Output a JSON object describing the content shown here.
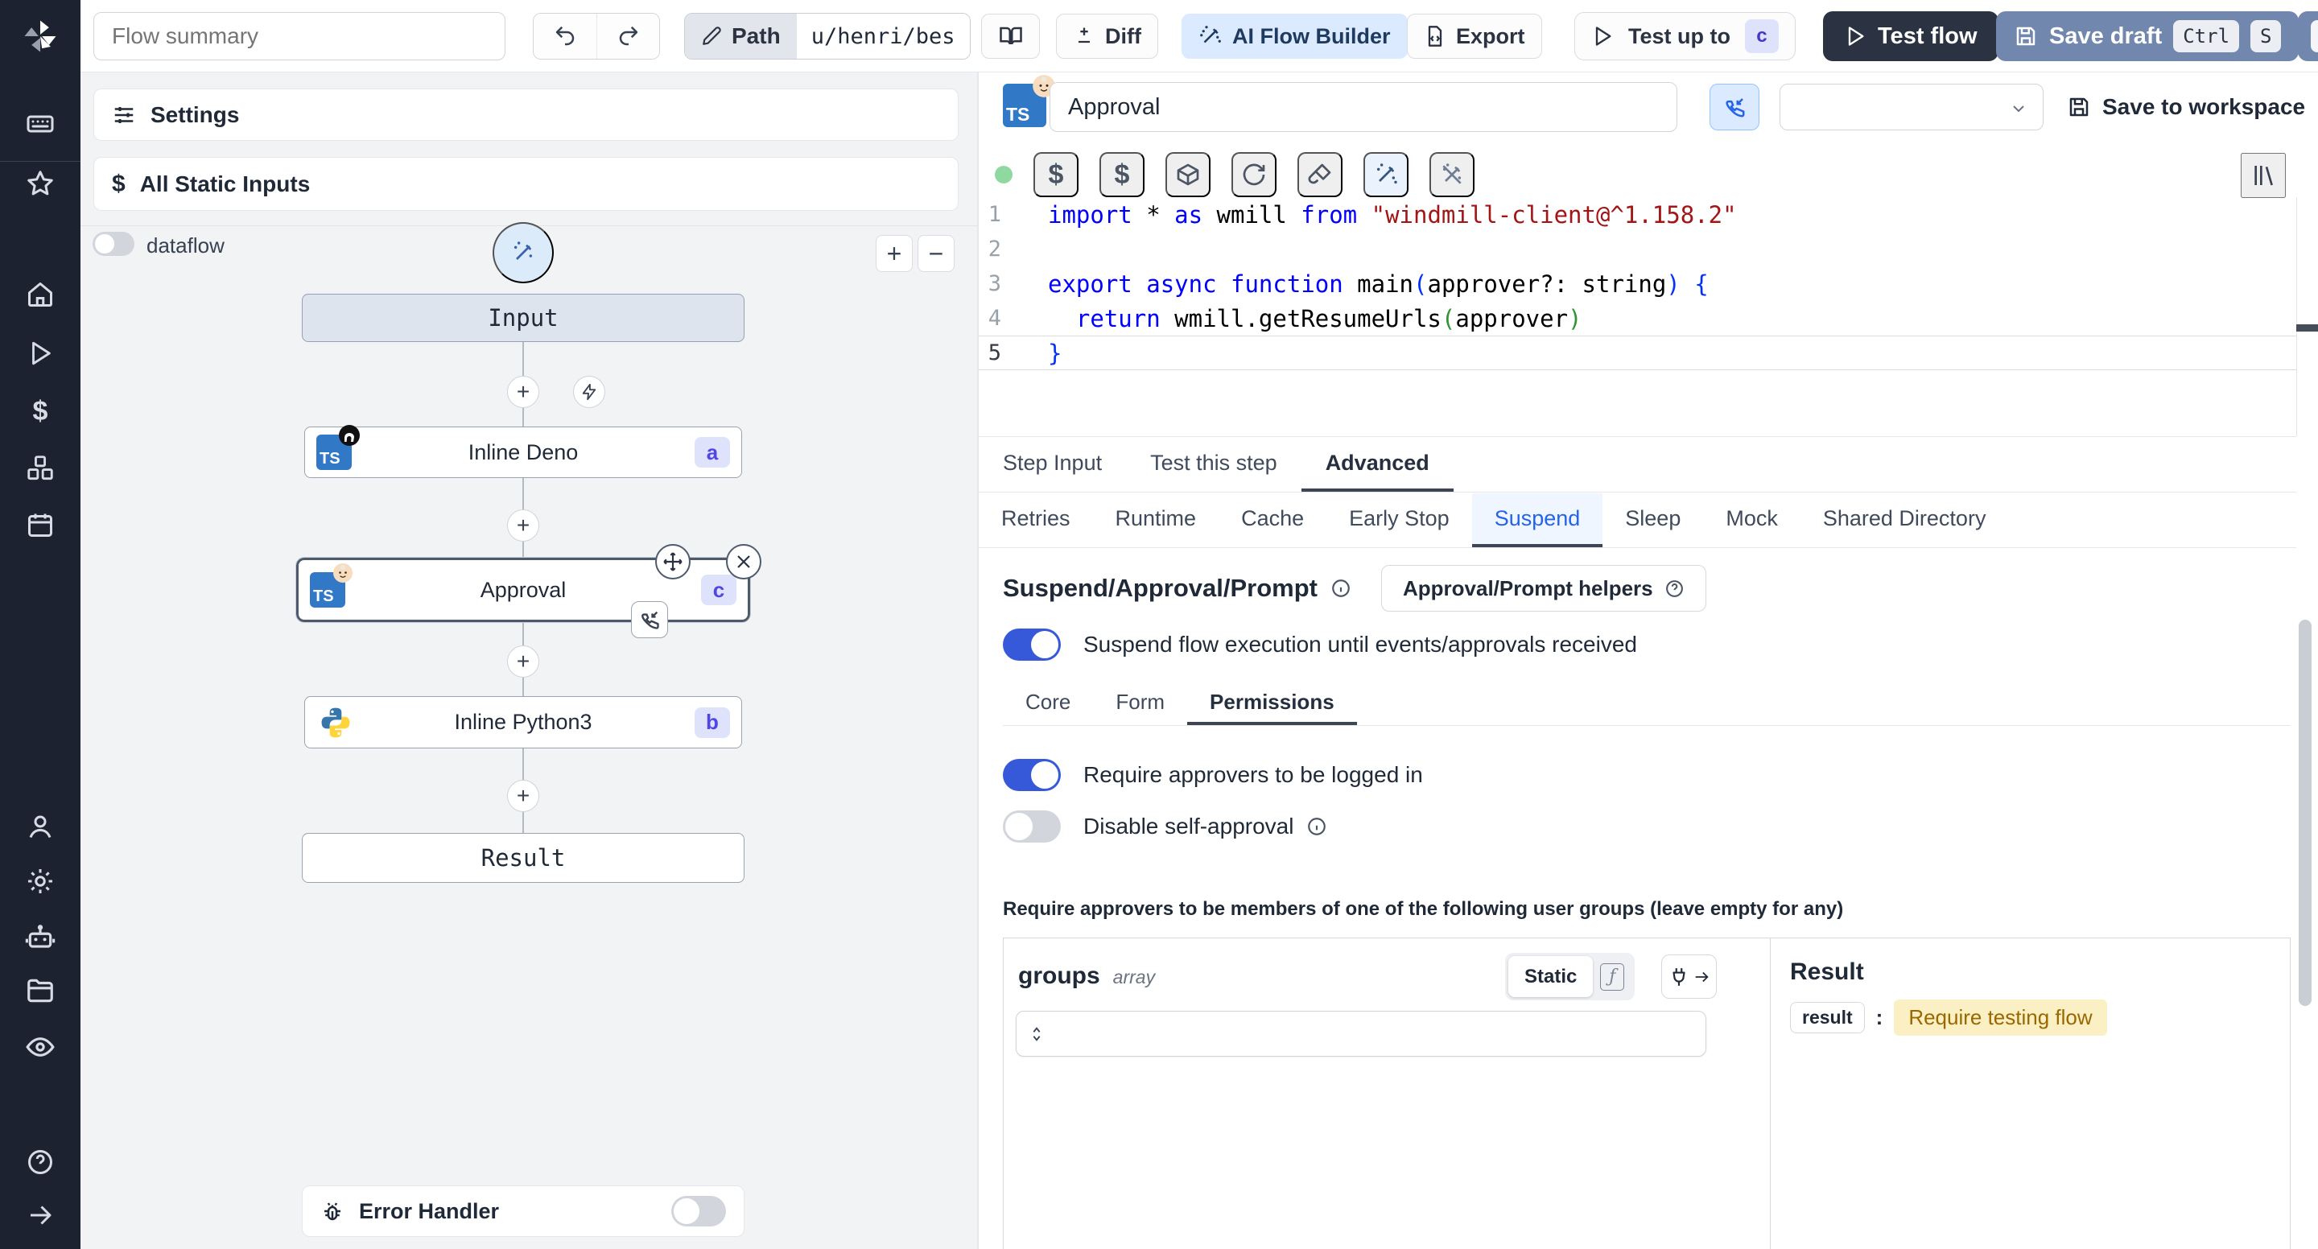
{
  "colors": {
    "accent_blue": "#2563eb",
    "toggle_on": "#3659d9",
    "ai_builder_bg": "#dbeafe",
    "test_flow_bg": "#2b3342",
    "save_draft_bg": "#7187ad",
    "badge_bg": "#dee3fb",
    "badge_text": "#4f46e5",
    "result_highlight_bg": "#fbf0c4",
    "result_highlight_text": "#9a6700",
    "status_dot": "#8fd9a0"
  },
  "topbar": {
    "flow_summary_placeholder": "Flow summary",
    "path_label": "Path",
    "path_value": "u/henri/bes",
    "diff_label": "Diff",
    "ai_flow_builder_label": "AI Flow Builder",
    "export_label": "Export",
    "test_up_to_label": "Test up to",
    "test_up_to_badge": "c",
    "test_flow_label": "Test flow",
    "save_draft_label": "Save draft",
    "save_draft_kbd_1": "Ctrl",
    "save_draft_kbd_2": "S"
  },
  "left_panel": {
    "settings_label": "Settings",
    "all_static_inputs_label": "All Static Inputs",
    "dataflow_label": "dataflow",
    "zoom_in_label": "+",
    "zoom_out_label": "−",
    "graph": {
      "input_label": "Input",
      "nodes": [
        {
          "label": "Inline Deno",
          "badge": "a"
        },
        {
          "label": "Approval",
          "badge": "c"
        },
        {
          "label": "Inline Python3",
          "badge": "b"
        }
      ],
      "result_label": "Result"
    },
    "error_handler_label": "Error Handler"
  },
  "step_header": {
    "ts_label": "TS",
    "step_name": "Approval",
    "save_to_workspace_label": "Save to workspace"
  },
  "editor": {
    "code": {
      "lines": [
        [
          [
            "kw",
            "import"
          ],
          [
            "pl",
            " * "
          ],
          [
            "kw",
            "as"
          ],
          [
            "pl",
            " wmill "
          ],
          [
            "kw",
            "from"
          ],
          [
            "pl",
            " "
          ],
          [
            "str",
            "\"windmill-client@^1.158.2\""
          ]
        ],
        [],
        [
          [
            "kw",
            "export"
          ],
          [
            "pl",
            " "
          ],
          [
            "kw",
            "async"
          ],
          [
            "pl",
            " "
          ],
          [
            "kw",
            "function"
          ],
          [
            "pl",
            " main"
          ],
          [
            "b1",
            "("
          ],
          [
            "pl",
            "approver?: string"
          ],
          [
            "b1",
            ")"
          ],
          [
            "pl",
            " "
          ],
          [
            "b1",
            "{"
          ]
        ],
        [
          [
            "pl",
            "  "
          ],
          [
            "kw",
            "return"
          ],
          [
            "pl",
            " wmill.getResumeUrls"
          ],
          [
            "b2",
            "("
          ],
          [
            "pl",
            "approver"
          ],
          [
            "b2",
            ")"
          ]
        ],
        [
          [
            "b1",
            "}"
          ]
        ]
      ],
      "current_line": 5
    }
  },
  "tabs": {
    "main": [
      {
        "label": "Step Input",
        "active": false
      },
      {
        "label": "Test this step",
        "active": false
      },
      {
        "label": "Advanced",
        "active": true
      }
    ],
    "advanced": [
      {
        "label": "Retries",
        "active": false
      },
      {
        "label": "Runtime",
        "active": false
      },
      {
        "label": "Cache",
        "active": false
      },
      {
        "label": "Early Stop",
        "active": false
      },
      {
        "label": "Suspend",
        "active": true
      },
      {
        "label": "Sleep",
        "active": false
      },
      {
        "label": "Mock",
        "active": false
      },
      {
        "label": "Shared Directory",
        "active": false
      }
    ],
    "suspend_sub": [
      {
        "label": "Core",
        "active": false
      },
      {
        "label": "Form",
        "active": false
      },
      {
        "label": "Permissions",
        "active": true
      }
    ]
  },
  "suspend": {
    "title": "Suspend/Approval/Prompt",
    "helpers_button_label": "Approval/Prompt helpers",
    "suspend_toggle_label": "Suspend flow execution until events/approvals received",
    "require_login_label": "Require approvers to be logged in",
    "disable_self_approval_label": "Disable self-approval",
    "groups_requirement_text": "Require approvers to be members of one of the following user groups (leave empty for any)"
  },
  "groups_panel": {
    "name": "groups",
    "type": "array",
    "static_label": "Static",
    "input_value": ""
  },
  "result_panel": {
    "title": "Result",
    "key": "result",
    "separator": ":",
    "value": "Require testing flow"
  }
}
